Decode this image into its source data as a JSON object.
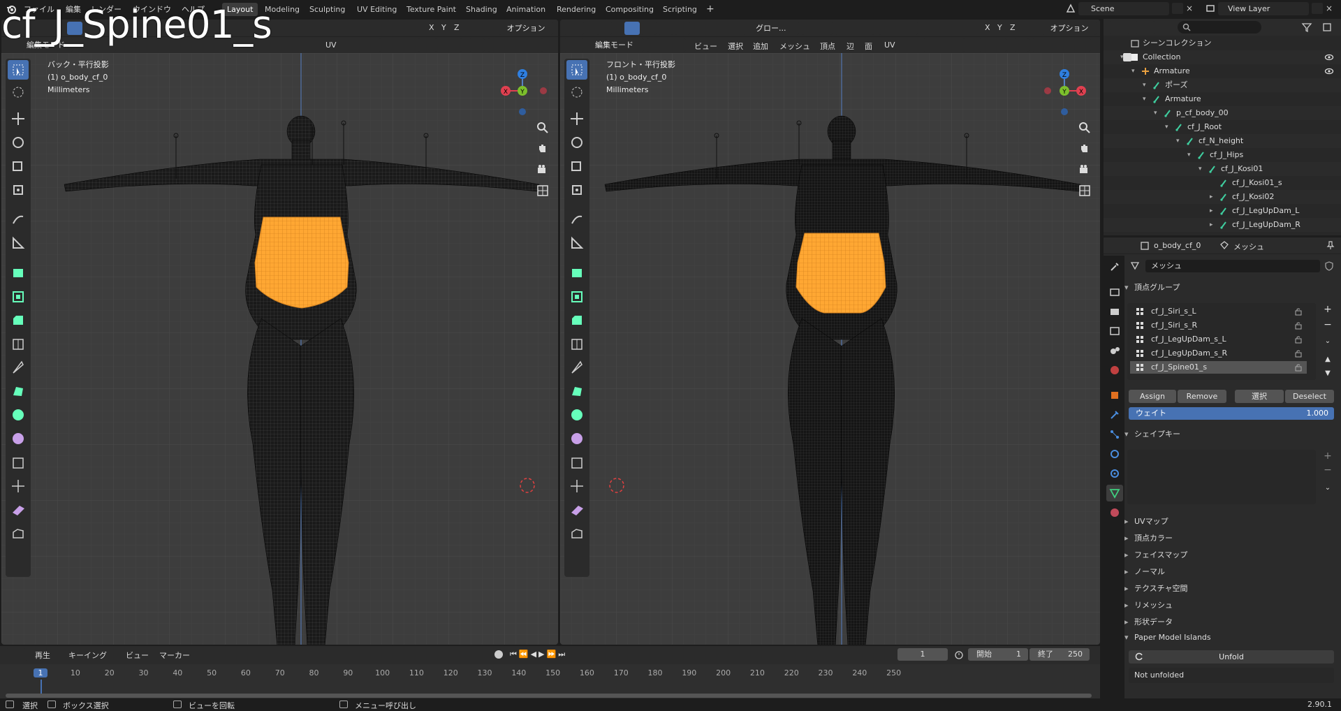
{
  "overlay_title": "cf_J_Spine01_s",
  "topbar": {
    "menus": [
      "ファイル",
      "編集",
      "レンダー",
      "ウインドウ",
      "ヘルプ"
    ],
    "workspaces": [
      "Layout",
      "Modeling",
      "Sculpting",
      "UV Editing",
      "Texture Paint",
      "Shading",
      "Animation",
      "Rendering",
      "Compositing",
      "Scripting"
    ],
    "active_workspace": "Layout",
    "add_tab": "+",
    "scene": "Scene",
    "view_layer": "View Layer"
  },
  "viewports": [
    {
      "mode": "編集モード",
      "menus": [
        "ビュー",
        "選択",
        "追加",
        "メッシュ",
        "頂点",
        "辺",
        "面",
        "UV"
      ],
      "view_name": "バック・平行投影",
      "object": "(1) o_body_cf_0",
      "units": "Millimeters",
      "transform": "グロー...",
      "options": "オプション",
      "axes": [
        "X",
        "Y",
        "Z"
      ]
    },
    {
      "mode": "編集モード",
      "menus": [
        "ビュー",
        "選択",
        "追加",
        "メッシュ",
        "頂点",
        "辺",
        "面",
        "UV"
      ],
      "view_name": "フロント・平行投影",
      "object": "(1) o_body_cf_0",
      "units": "Millimeters",
      "transform": "グロー...",
      "options": "オプション",
      "axes": [
        "X",
        "Y",
        "Z"
      ]
    }
  ],
  "gizmo_labels": {
    "x": "X",
    "y": "Y",
    "z": "Z"
  },
  "outliner": {
    "title": "シーンコレクション",
    "rows": [
      {
        "label": "Collection",
        "depth": 1
      },
      {
        "label": "Armature",
        "depth": 2
      },
      {
        "label": "ポーズ",
        "depth": 3
      },
      {
        "label": "Armature",
        "depth": 3
      },
      {
        "label": "p_cf_body_00",
        "depth": 4
      },
      {
        "label": "cf_J_Root",
        "depth": 5
      },
      {
        "label": "cf_N_height",
        "depth": 6
      },
      {
        "label": "cf_J_Hips",
        "depth": 7
      },
      {
        "label": "cf_J_Kosi01",
        "depth": 8
      },
      {
        "label": "cf_J_Kosi01_s",
        "depth": 9
      },
      {
        "label": "cf_J_Kosi02",
        "depth": 9
      },
      {
        "label": "cf_J_LegUpDam_L",
        "depth": 9
      },
      {
        "label": "cf_J_LegUpDam_R",
        "depth": 9
      }
    ]
  },
  "properties": {
    "object_name": "o_body_cf_0",
    "data_name": "メッシュ",
    "mesh_field": "メッシュ",
    "vertex_groups_header": "頂点グループ",
    "vertex_groups": [
      "cf_J_Siri_s_L",
      "cf_J_Siri_s_R",
      "cf_J_LegUpDam_s_L",
      "cf_J_LegUpDam_s_R",
      "cf_J_Spine01_s"
    ],
    "selected_group": "cf_J_Spine01_s",
    "buttons": {
      "assign": "Assign",
      "remove": "Remove",
      "select": "選択",
      "deselect": "Deselect"
    },
    "weight_label": "ウェイト",
    "weight_value": "1.000",
    "shape_keys_header": "シェイプキー",
    "collapsed_panels": [
      "UVマップ",
      "頂点カラー",
      "フェイスマップ",
      "ノーマル",
      "テクスチャ空間",
      "リメッシュ",
      "形状データ"
    ],
    "paper_model_header": "Paper Model Islands",
    "unfold_label": "Unfold",
    "not_unfolded": "Not unfolded"
  },
  "timeline": {
    "menus": [
      "再生",
      "キーイング",
      "ビュー",
      "マーカー"
    ],
    "current_frame": "1",
    "start_label": "開始",
    "start_value": "1",
    "end_label": "終了",
    "end_value": "250",
    "ticks": [
      "1",
      "10",
      "20",
      "30",
      "40",
      "50",
      "60",
      "70",
      "80",
      "90",
      "100",
      "110",
      "120",
      "130",
      "140",
      "150",
      "160",
      "170",
      "180",
      "190",
      "200",
      "210",
      "220",
      "230",
      "240",
      "250"
    ]
  },
  "statusbar": {
    "select": "選択",
    "box_select": "ボックス選択",
    "rotate": "ビューを回転",
    "menu": "メニュー呼び出し",
    "version": "2.90.1"
  },
  "colors": {
    "accent": "#4772b3",
    "selection": "#ffa733",
    "wire": "#000000",
    "viewport_bg": "#3d3d3d"
  }
}
